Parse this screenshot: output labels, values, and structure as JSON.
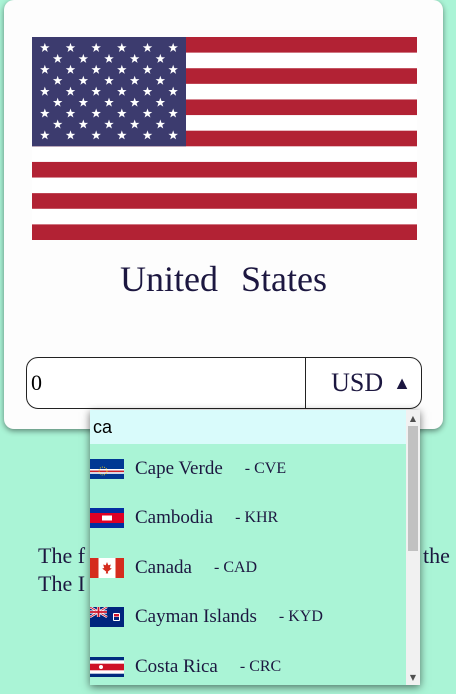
{
  "country": {
    "name": "United States",
    "flag_icon": "us-flag",
    "flag_colors": {
      "red": "#b22234",
      "blue": "#3c3b6e",
      "white": "#ffffff"
    }
  },
  "converter": {
    "amount_value": "0",
    "currency_code": "USD",
    "arrow_glyph": "▲"
  },
  "body_text": {
    "line1_start": "The f",
    "line1_end": "the",
    "line2_start": "The I"
  },
  "dropdown": {
    "search_value": "ca",
    "items": [
      {
        "name": "Cape Verde",
        "code": "- CVE",
        "flag_icon": "cape-verde-flag"
      },
      {
        "name": "Cambodia",
        "code": "- KHR",
        "flag_icon": "cambodia-flag"
      },
      {
        "name": "Canada",
        "code": "- CAD",
        "flag_icon": "canada-flag"
      },
      {
        "name": "Cayman Islands",
        "code": "- KYD",
        "flag_icon": "cayman-islands-flag"
      },
      {
        "name": "Costa Rica",
        "code": "- CRC",
        "flag_icon": "costa-rica-flag"
      }
    ]
  },
  "colors": {
    "page_background": "#aaf4d6",
    "card_background": "#fdfdfd",
    "search_background": "#d9fbfb",
    "text": "#1c1740"
  }
}
